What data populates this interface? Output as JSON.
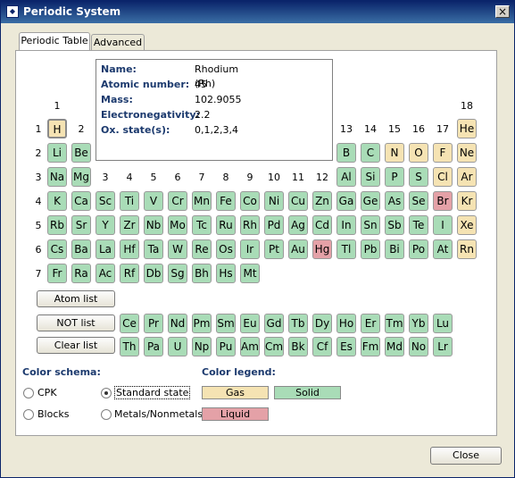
{
  "window": {
    "title": "Periodic System",
    "close_glyph": "×"
  },
  "tabs": [
    {
      "label": "Periodic Table",
      "active": true
    },
    {
      "label": "Advanced",
      "active": false
    }
  ],
  "info": {
    "name_label": "Name:",
    "name": "Rhodium (Rh)",
    "atomic_number_label": "Atomic number:",
    "atomic_number": "45",
    "mass_label": "Mass:",
    "mass": "102.9055",
    "electronegativity_label": "Electronegativity:",
    "electronegativity": "2.2",
    "ox_label": "Ox. state(s):",
    "ox_states": "0,1,2,3,4"
  },
  "group_numbers": {
    "g1": "1",
    "g2": "2",
    "g13": "13",
    "g14": "14",
    "g15": "15",
    "g16": "16",
    "g17": "17",
    "g18": "18",
    "transition": [
      "3",
      "4",
      "5",
      "6",
      "7",
      "8",
      "9",
      "10",
      "11",
      "12"
    ]
  },
  "period_numbers": [
    "1",
    "2",
    "3",
    "4",
    "5",
    "6",
    "7"
  ],
  "rows": {
    "p1": [
      {
        "s": "H",
        "st": "gas",
        "sel": true
      },
      {
        "s": "He",
        "st": "gas"
      }
    ],
    "p2a": [
      {
        "s": "Li",
        "st": "solid"
      },
      {
        "s": "Be",
        "st": "solid"
      }
    ],
    "p2b": [
      {
        "s": "B",
        "st": "solid"
      },
      {
        "s": "C",
        "st": "solid"
      },
      {
        "s": "N",
        "st": "gas"
      },
      {
        "s": "O",
        "st": "gas"
      },
      {
        "s": "F",
        "st": "gas"
      },
      {
        "s": "Ne",
        "st": "gas"
      }
    ],
    "p3a": [
      {
        "s": "Na",
        "st": "solid"
      },
      {
        "s": "Mg",
        "st": "solid"
      }
    ],
    "p3b": [
      {
        "s": "Al",
        "st": "solid"
      },
      {
        "s": "Si",
        "st": "solid"
      },
      {
        "s": "P",
        "st": "solid"
      },
      {
        "s": "S",
        "st": "solid"
      },
      {
        "s": "Cl",
        "st": "gas"
      },
      {
        "s": "Ar",
        "st": "gas"
      }
    ],
    "p4": [
      {
        "s": "K",
        "st": "solid"
      },
      {
        "s": "Ca",
        "st": "solid"
      },
      {
        "s": "Sc",
        "st": "solid"
      },
      {
        "s": "Ti",
        "st": "solid"
      },
      {
        "s": "V",
        "st": "solid"
      },
      {
        "s": "Cr",
        "st": "solid"
      },
      {
        "s": "Mn",
        "st": "solid"
      },
      {
        "s": "Fe",
        "st": "solid"
      },
      {
        "s": "Co",
        "st": "solid"
      },
      {
        "s": "Ni",
        "st": "solid"
      },
      {
        "s": "Cu",
        "st": "solid"
      },
      {
        "s": "Zn",
        "st": "solid"
      },
      {
        "s": "Ga",
        "st": "solid"
      },
      {
        "s": "Ge",
        "st": "solid"
      },
      {
        "s": "As",
        "st": "solid"
      },
      {
        "s": "Se",
        "st": "solid"
      },
      {
        "s": "Br",
        "st": "liquid"
      },
      {
        "s": "Kr",
        "st": "gas"
      }
    ],
    "p5": [
      {
        "s": "Rb",
        "st": "solid"
      },
      {
        "s": "Sr",
        "st": "solid"
      },
      {
        "s": "Y",
        "st": "solid"
      },
      {
        "s": "Zr",
        "st": "solid"
      },
      {
        "s": "Nb",
        "st": "solid"
      },
      {
        "s": "Mo",
        "st": "solid"
      },
      {
        "s": "Tc",
        "st": "solid"
      },
      {
        "s": "Ru",
        "st": "solid"
      },
      {
        "s": "Rh",
        "st": "solid"
      },
      {
        "s": "Pd",
        "st": "solid"
      },
      {
        "s": "Ag",
        "st": "solid"
      },
      {
        "s": "Cd",
        "st": "solid"
      },
      {
        "s": "In",
        "st": "solid"
      },
      {
        "s": "Sn",
        "st": "solid"
      },
      {
        "s": "Sb",
        "st": "solid"
      },
      {
        "s": "Te",
        "st": "solid"
      },
      {
        "s": "I",
        "st": "solid"
      },
      {
        "s": "Xe",
        "st": "gas"
      }
    ],
    "p6": [
      {
        "s": "Cs",
        "st": "solid"
      },
      {
        "s": "Ba",
        "st": "solid"
      },
      {
        "s": "La",
        "st": "solid"
      },
      {
        "s": "Hf",
        "st": "solid"
      },
      {
        "s": "Ta",
        "st": "solid"
      },
      {
        "s": "W",
        "st": "solid"
      },
      {
        "s": "Re",
        "st": "solid"
      },
      {
        "s": "Os",
        "st": "solid"
      },
      {
        "s": "Ir",
        "st": "solid"
      },
      {
        "s": "Pt",
        "st": "solid"
      },
      {
        "s": "Au",
        "st": "solid"
      },
      {
        "s": "Hg",
        "st": "liquid"
      },
      {
        "s": "Tl",
        "st": "solid"
      },
      {
        "s": "Pb",
        "st": "solid"
      },
      {
        "s": "Bi",
        "st": "solid"
      },
      {
        "s": "Po",
        "st": "solid"
      },
      {
        "s": "At",
        "st": "solid"
      },
      {
        "s": "Rn",
        "st": "gas"
      }
    ],
    "p7": [
      {
        "s": "Fr",
        "st": "solid"
      },
      {
        "s": "Ra",
        "st": "solid"
      },
      {
        "s": "Ac",
        "st": "solid"
      },
      {
        "s": "Rf",
        "st": "solid"
      },
      {
        "s": "Db",
        "st": "solid"
      },
      {
        "s": "Sg",
        "st": "solid"
      },
      {
        "s": "Bh",
        "st": "solid"
      },
      {
        "s": "Hs",
        "st": "solid"
      },
      {
        "s": "Mt",
        "st": "solid"
      }
    ],
    "lanth": [
      {
        "s": "Ce",
        "st": "solid"
      },
      {
        "s": "Pr",
        "st": "solid"
      },
      {
        "s": "Nd",
        "st": "solid"
      },
      {
        "s": "Pm",
        "st": "solid"
      },
      {
        "s": "Sm",
        "st": "solid"
      },
      {
        "s": "Eu",
        "st": "solid"
      },
      {
        "s": "Gd",
        "st": "solid"
      },
      {
        "s": "Tb",
        "st": "solid"
      },
      {
        "s": "Dy",
        "st": "solid"
      },
      {
        "s": "Ho",
        "st": "solid"
      },
      {
        "s": "Er",
        "st": "solid"
      },
      {
        "s": "Tm",
        "st": "solid"
      },
      {
        "s": "Yb",
        "st": "solid"
      },
      {
        "s": "Lu",
        "st": "solid"
      }
    ],
    "actin": [
      {
        "s": "Th",
        "st": "solid"
      },
      {
        "s": "Pa",
        "st": "solid"
      },
      {
        "s": "U",
        "st": "solid"
      },
      {
        "s": "Np",
        "st": "solid"
      },
      {
        "s": "Pu",
        "st": "solid"
      },
      {
        "s": "Am",
        "st": "solid"
      },
      {
        "s": "Cm",
        "st": "solid"
      },
      {
        "s": "Bk",
        "st": "solid"
      },
      {
        "s": "Cf",
        "st": "solid"
      },
      {
        "s": "Es",
        "st": "solid"
      },
      {
        "s": "Fm",
        "st": "solid"
      },
      {
        "s": "Md",
        "st": "solid"
      },
      {
        "s": "No",
        "st": "solid"
      },
      {
        "s": "Lr",
        "st": "solid"
      }
    ]
  },
  "buttons": {
    "atom_list": "Atom list",
    "not_list": "NOT list",
    "clear_list": "Clear list",
    "close": "Close"
  },
  "color_schema": {
    "heading": "Color schema:",
    "options": [
      "CPK",
      "Standard state",
      "Blocks",
      "Metals/Nonmetals"
    ],
    "selected": "Standard state"
  },
  "color_legend": {
    "heading": "Color legend:",
    "gas": "Gas",
    "solid": "Solid",
    "liquid": "Liquid"
  },
  "colors": {
    "solid": "#a9dcb7",
    "gas": "#f5e3b3",
    "liquid": "#e4a1a7",
    "heading": "#1c3a6e"
  }
}
